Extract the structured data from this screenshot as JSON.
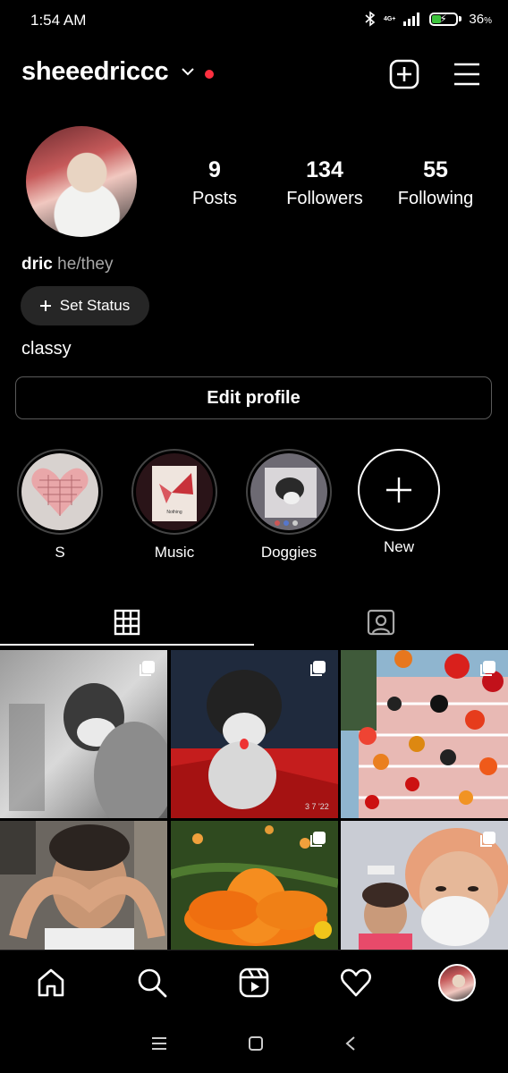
{
  "status_bar": {
    "time": "1:54 AM",
    "network": "4G+",
    "battery_percent": "36",
    "battery_sign": "%"
  },
  "header": {
    "username": "sheeedriccc"
  },
  "profile": {
    "stats": [
      {
        "value": "9",
        "label": "Posts"
      },
      {
        "value": "134",
        "label": "Followers"
      },
      {
        "value": "55",
        "label": "Following"
      }
    ],
    "name": "dric",
    "pronouns": "he/they",
    "set_status_label": "Set Status",
    "bio": "classy",
    "edit_profile_label": "Edit profile"
  },
  "highlights": [
    {
      "label": "S"
    },
    {
      "label": "Music",
      "thumb_caption": "Nothing"
    },
    {
      "label": "Doggies"
    },
    {
      "label": "New"
    }
  ],
  "tabs": [
    {
      "icon": "grid-icon"
    },
    {
      "icon": "tagged-icon"
    }
  ],
  "posts": [
    {
      "desc": "grayscale selfie",
      "multi": true
    },
    {
      "desc": "dog on red blanket",
      "multi": true,
      "stamp": "3 7 '22"
    },
    {
      "desc": "lanterns",
      "multi": true
    },
    {
      "desc": "heart hands",
      "multi": false
    },
    {
      "desc": "orange flower",
      "multi": true
    },
    {
      "desc": "two people selfie",
      "multi": true
    }
  ],
  "bottom_nav": [
    "home-icon",
    "search-icon",
    "reels-icon",
    "heart-icon",
    "profile-avatar"
  ],
  "colors": {
    "background": "#000000",
    "notification_dot": "#ff3040",
    "battery_fill": "#3ec43e",
    "button_bg": "#262626"
  }
}
